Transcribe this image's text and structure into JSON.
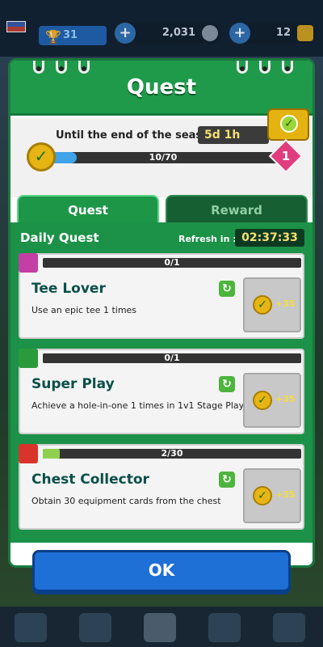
{
  "top": {
    "trophies": "31",
    "coins": "2,031",
    "gems": "12"
  },
  "modal": {
    "title": "Quest",
    "season_label": "Until the end of the season:",
    "season_time": "5d 1h",
    "progress_text": "10/70",
    "progress_fraction": 0.14,
    "level": "1",
    "tabs": [
      "Quest",
      "Reward"
    ],
    "daily_title": "Daily Quest",
    "refresh_label": "Refresh in :",
    "refresh_time": "02:37:33",
    "quests": [
      {
        "title": "Tee Lover",
        "desc": "Use an epic tee 1 times",
        "progress": "0/1",
        "fraction": 0,
        "points": "+35",
        "tag_color": "#c33ea5"
      },
      {
        "title": "Super Play",
        "desc": "Achieve a hole-in-one 1 times in 1v1 Stage Play",
        "progress": "0/1",
        "fraction": 0,
        "points": "+35",
        "tag_color": "#2b9a3b"
      },
      {
        "title": "Chest Collector",
        "desc": "Obtain 30 equipment cards from the chest",
        "progress": "2/30",
        "fraction": 0.067,
        "points": "+35",
        "tag_color": "#d9342b"
      }
    ],
    "ok_label": "OK"
  },
  "icons": {
    "plus": "+",
    "check": "✓",
    "refresh": "↻"
  }
}
